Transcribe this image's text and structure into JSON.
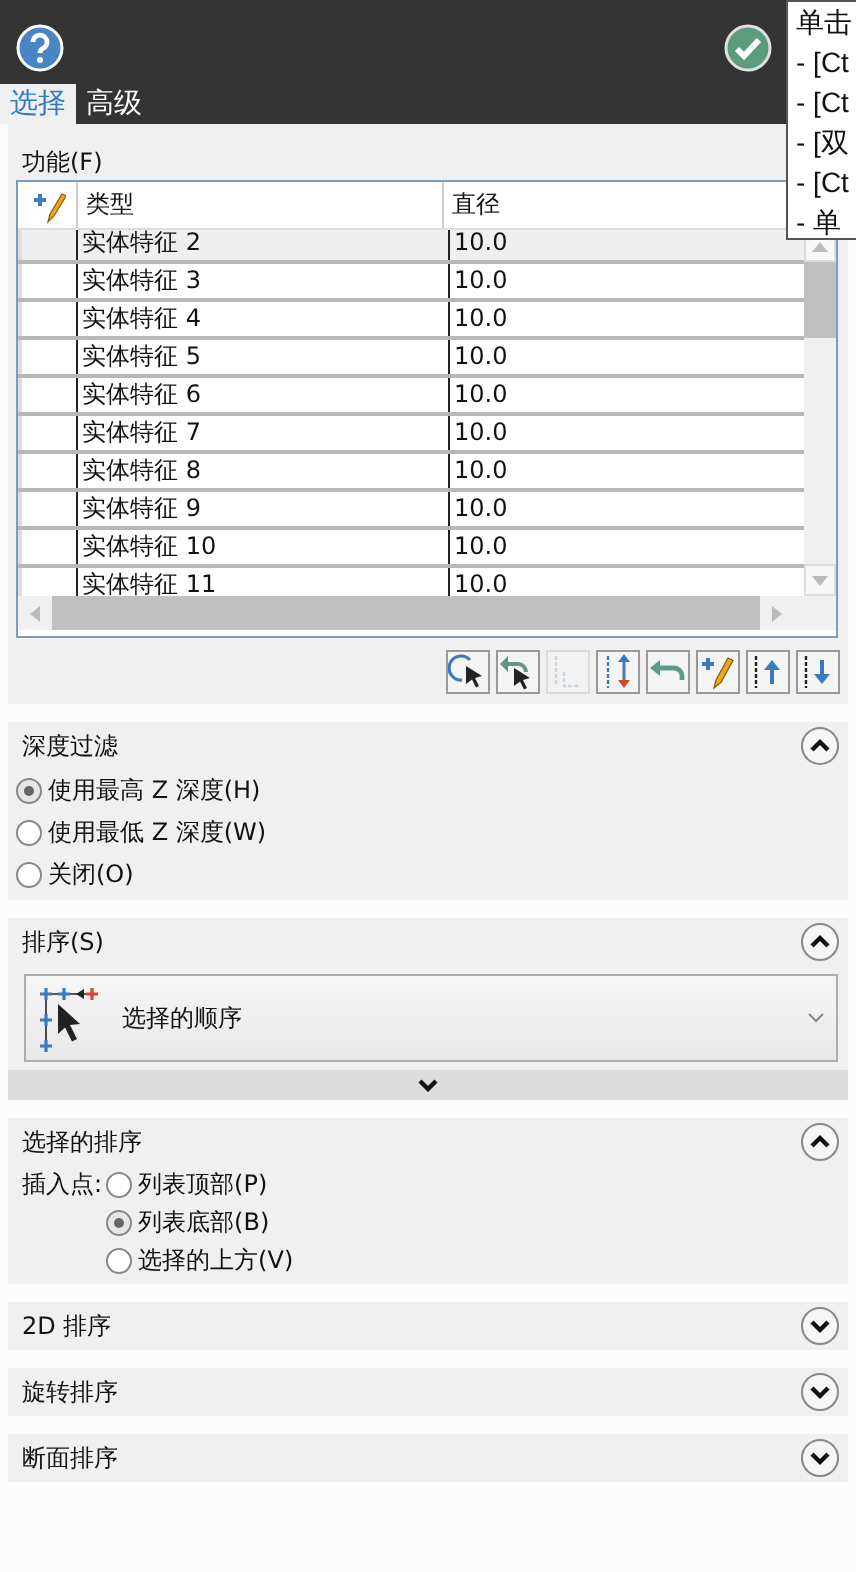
{
  "header": {
    "tabs": [
      {
        "label": "选择",
        "selected": true
      },
      {
        "label": "高级",
        "selected": false
      }
    ]
  },
  "tooltip": {
    "lines": [
      "单击",
      "- [Ct",
      "- [Ct",
      "- [双",
      "- [Ct",
      "- 单"
    ]
  },
  "features": {
    "label": "功能(F)",
    "table": {
      "columns": [
        "类型",
        "直径"
      ],
      "rows": [
        {
          "type": "实体特征 2",
          "diameter": "10.0",
          "selected": true
        },
        {
          "type": "实体特征 3",
          "diameter": "10.0",
          "selected": false
        },
        {
          "type": "实体特征 4",
          "diameter": "10.0",
          "selected": false
        },
        {
          "type": "实体特征 5",
          "diameter": "10.0",
          "selected": false
        },
        {
          "type": "实体特征 6",
          "diameter": "10.0",
          "selected": false
        },
        {
          "type": "实体特征 7",
          "diameter": "10.0",
          "selected": false
        },
        {
          "type": "实体特征 8",
          "diameter": "10.0",
          "selected": false
        },
        {
          "type": "实体特征 9",
          "diameter": "10.0",
          "selected": false
        },
        {
          "type": "实体特征 10",
          "diameter": "10.0",
          "selected": false
        },
        {
          "type": "实体特征 11",
          "diameter": "10.0",
          "selected": false
        }
      ]
    },
    "tools": [
      {
        "kind": "select",
        "disabled": false
      },
      {
        "kind": "reselect",
        "disabled": false
      },
      {
        "kind": "reorder",
        "disabled": true
      },
      {
        "kind": "reverse",
        "disabled": false
      },
      {
        "kind": "undo",
        "disabled": false
      },
      {
        "kind": "edit",
        "disabled": false
      },
      {
        "kind": "up",
        "disabled": false
      },
      {
        "kind": "down",
        "disabled": false
      }
    ]
  },
  "sections": [
    {
      "kind": "radios",
      "title": "深度过滤",
      "expanded": true,
      "options": [
        {
          "label": "使用最高 Z 深度(H)",
          "selected": true
        },
        {
          "label": "使用最低 Z 深度(W)",
          "selected": false
        },
        {
          "label": "关闭(O)",
          "selected": false
        }
      ]
    },
    {
      "kind": "dropdown",
      "title": "排序(S)",
      "expanded": true,
      "value": "选择的顺序",
      "more": false
    },
    {
      "kind": "radios",
      "title": "选择的排序",
      "expanded": true,
      "prefix": "插入点:",
      "options": [
        {
          "label": "列表顶部(P)",
          "selected": false
        },
        {
          "label": "列表底部(B)",
          "selected": true
        },
        {
          "label": "选择的上方(V)",
          "selected": false
        }
      ]
    },
    {
      "title": "2D 排序",
      "expanded": false
    },
    {
      "title": "旋转排序",
      "expanded": false
    },
    {
      "title": "断面排序",
      "expanded": false
    }
  ]
}
